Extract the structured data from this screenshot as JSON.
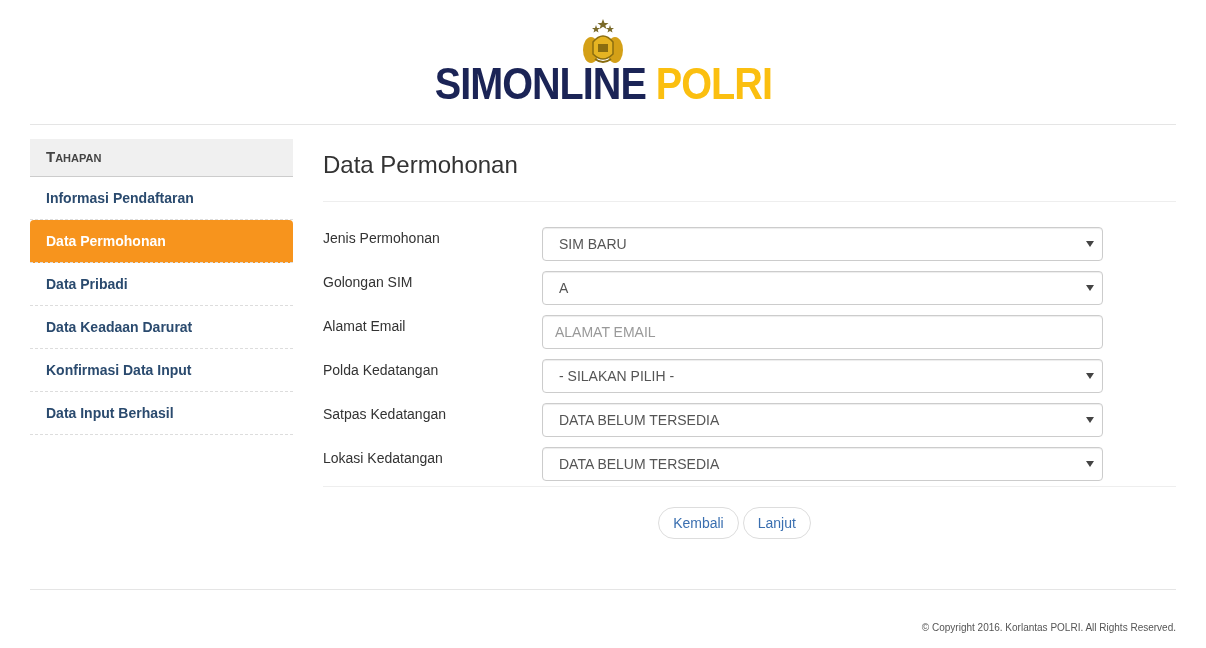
{
  "logo": {
    "primary": "SIMONLINE",
    "secondary": "POLRI"
  },
  "sidebar": {
    "title": "Tahapan",
    "items": [
      {
        "label": "Informasi Pendaftaran",
        "selected": false
      },
      {
        "label": "Data Permohonan",
        "selected": true
      },
      {
        "label": "Data Pribadi",
        "selected": false
      },
      {
        "label": "Data Keadaan Darurat",
        "selected": false
      },
      {
        "label": "Konfirmasi Data Input",
        "selected": false
      },
      {
        "label": "Data Input Berhasil",
        "selected": false
      }
    ]
  },
  "page_title": "Data Permohonan",
  "fields": [
    {
      "label": "Jenis Permohonan",
      "kind": "select",
      "value": "SIM BARU"
    },
    {
      "label": "Golongan SIM",
      "kind": "select",
      "value": "A"
    },
    {
      "label": "Alamat Email",
      "kind": "input",
      "placeholder": "ALAMAT EMAIL"
    },
    {
      "label": "Polda Kedatangan",
      "kind": "select",
      "value": "- SILAKAN PILIH -"
    },
    {
      "label": "Satpas Kedatangan",
      "kind": "select",
      "value": "DATA BELUM TERSEDIA"
    },
    {
      "label": "Lokasi Kedatangan",
      "kind": "select",
      "value": "DATA BELUM TERSEDIA"
    }
  ],
  "buttons": [
    "Kembali",
    "Lanjut"
  ],
  "footer": "© Copyright 2016. Korlantas POLRI. All Rights Reserved."
}
